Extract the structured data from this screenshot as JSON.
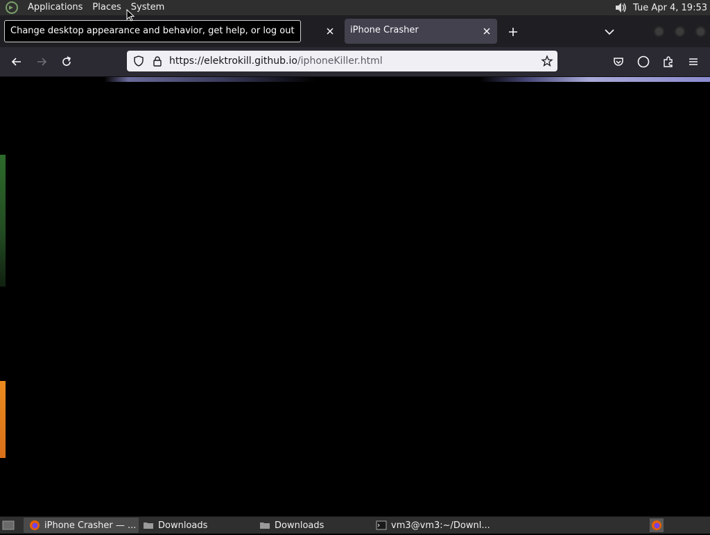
{
  "top_panel": {
    "menus": [
      "Applications",
      "Places",
      "System"
    ],
    "clock": "Tue Apr  4, 19:53"
  },
  "tooltip": {
    "text": "Change desktop appearance and behavior, get help, or log out"
  },
  "browser": {
    "tabs": [
      {
        "label": "",
        "active": false
      },
      {
        "label": "iPhone Crasher",
        "active": true
      }
    ],
    "url": {
      "host": "https://elektrokill.github.io",
      "path": "/iphoneKiller.html"
    }
  },
  "taskbar": {
    "tasks": [
      {
        "label": "iPhone Crasher — ...",
        "icon": "firefox-icon",
        "active": true
      },
      {
        "label": "Downloads",
        "icon": "folder-icon",
        "active": false
      },
      {
        "label": "Downloads",
        "icon": "folder-icon",
        "active": false
      },
      {
        "label": "vm3@vm3:~/Downl...",
        "icon": "terminal-icon",
        "active": false
      }
    ]
  },
  "colors": {
    "panel": "#2f2f2f",
    "tabbar": "#1f1f23",
    "toolbar": "#2b2a33",
    "urlbar": "#f0f0f4",
    "page_background": "#000000"
  }
}
